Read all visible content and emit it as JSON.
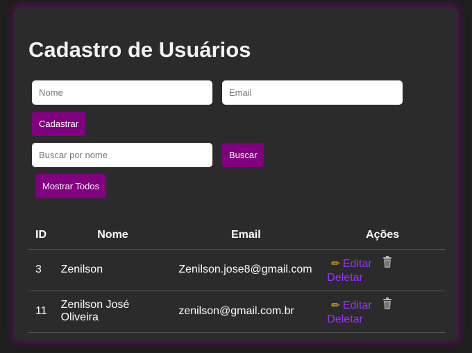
{
  "title": "Cadastro de Usuários",
  "form": {
    "name_placeholder": "Nome",
    "email_placeholder": "Email",
    "submit_label": "Cadastrar"
  },
  "search": {
    "placeholder": "Buscar por nome",
    "search_label": "Buscar",
    "show_all_label": "Mostrar Todos"
  },
  "table": {
    "headers": {
      "id": "ID",
      "name": "Nome",
      "email": "Email",
      "actions": "Ações"
    },
    "rows": [
      {
        "id": "3",
        "name": "Zenilson",
        "email": "Zenilson.jose8@gmail.com"
      },
      {
        "id": "11",
        "name": "Zenilson José Oliveira",
        "email": "zenilson@gmail.com.br"
      }
    ],
    "edit_label": "Editar",
    "delete_label": "Deletar"
  },
  "colors": {
    "accent": "#800080",
    "link": "#9b30ff",
    "card": "#2b2b2b"
  },
  "icons": {
    "edit": "pencil-icon",
    "delete": "trash-icon"
  }
}
